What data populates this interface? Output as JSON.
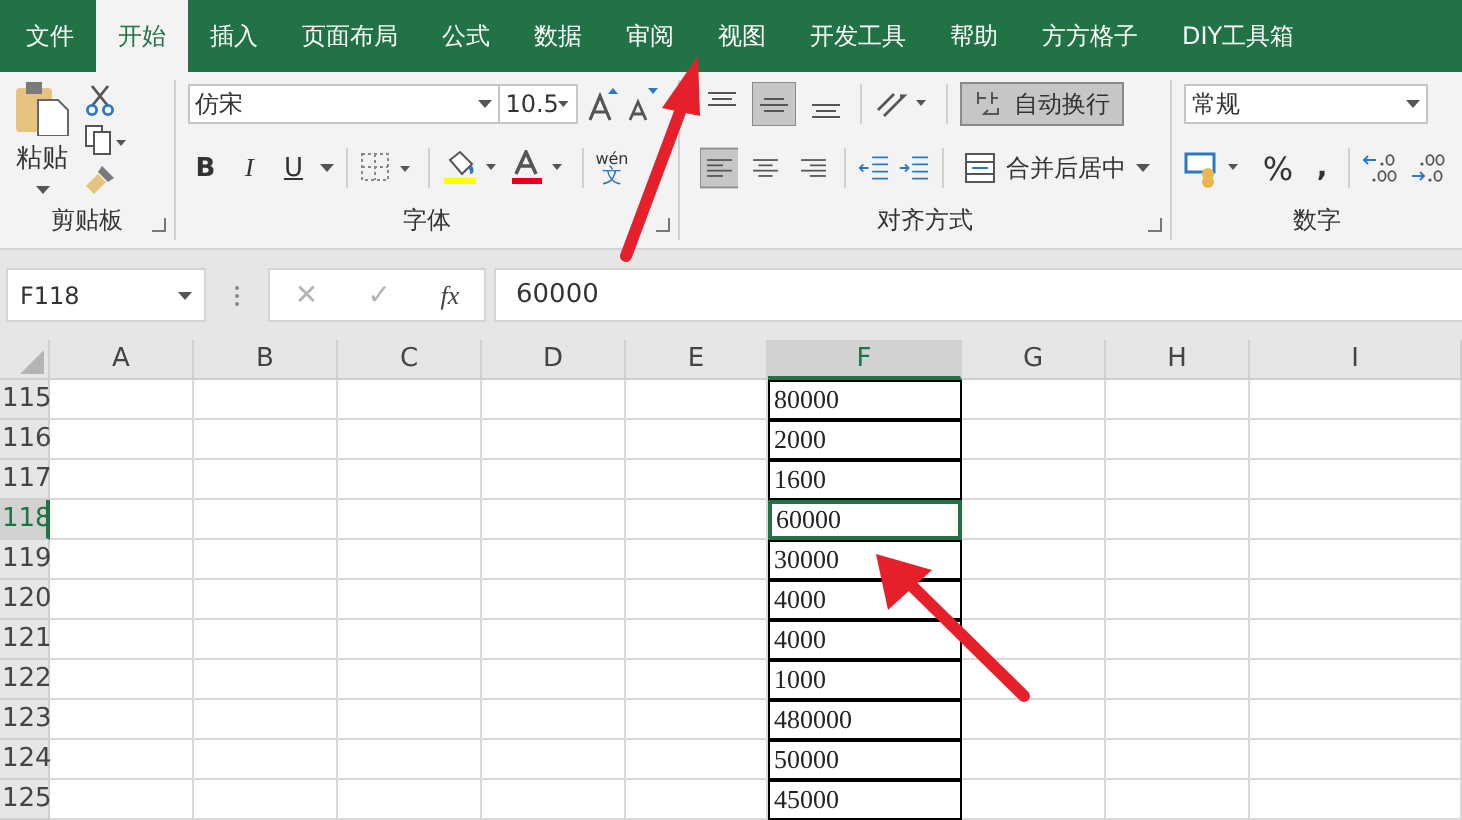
{
  "tabs": [
    {
      "label": "文件",
      "selected": false
    },
    {
      "label": "开始",
      "selected": true
    },
    {
      "label": "插入",
      "selected": false
    },
    {
      "label": "页面布局",
      "selected": false
    },
    {
      "label": "公式",
      "selected": false
    },
    {
      "label": "数据",
      "selected": false
    },
    {
      "label": "审阅",
      "selected": false
    },
    {
      "label": "视图",
      "selected": false
    },
    {
      "label": "开发工具",
      "selected": false
    },
    {
      "label": "帮助",
      "selected": false
    },
    {
      "label": "方方格子",
      "selected": false
    },
    {
      "label": "DIY工具箱",
      "selected": false
    }
  ],
  "clipboard": {
    "paste_label": "粘贴",
    "group_label": "剪贴板"
  },
  "font": {
    "font_name": "仿宋",
    "font_size": "10.5",
    "bold": "B",
    "italic": "I",
    "underline": "U",
    "phonetic_top": "wén",
    "phonetic_bottom": "文",
    "group_label": "字体"
  },
  "alignment": {
    "vertical": [
      {
        "kind": "top",
        "selected": false
      },
      {
        "kind": "middle",
        "selected": true
      },
      {
        "kind": "bottom",
        "selected": false
      }
    ],
    "horizontal": [
      {
        "kind": "left",
        "selected": true
      },
      {
        "kind": "center",
        "selected": false
      },
      {
        "kind": "right",
        "selected": false
      }
    ],
    "wrap_text": {
      "label": "自动换行",
      "selected": true
    },
    "merge_label": "合并后居中",
    "group_label": "对齐方式"
  },
  "number": {
    "format": "常规",
    "percent": "%",
    "comma": ",",
    "group_label": "数字"
  },
  "formula_bar": {
    "name_box": "F118",
    "cancel": "✕",
    "enter": "✓",
    "fx": "fx",
    "value": "60000"
  },
  "columns": [
    {
      "label": "A",
      "selected": false
    },
    {
      "label": "B",
      "selected": false
    },
    {
      "label": "C",
      "selected": false
    },
    {
      "label": "D",
      "selected": false
    },
    {
      "label": "E",
      "selected": false
    },
    {
      "label": "F",
      "selected": true
    },
    {
      "label": "G",
      "selected": false
    },
    {
      "label": "H",
      "selected": false
    },
    {
      "label": "I",
      "selected": false
    }
  ],
  "rows": [
    {
      "number": "115",
      "selected": false,
      "value": "80000"
    },
    {
      "number": "116",
      "selected": false,
      "value": "2000"
    },
    {
      "number": "117",
      "selected": false,
      "value": "1600"
    },
    {
      "number": "118",
      "selected": true,
      "value": "60000"
    },
    {
      "number": "119",
      "selected": false,
      "value": "30000"
    },
    {
      "number": "120",
      "selected": false,
      "value": "4000"
    },
    {
      "number": "121",
      "selected": false,
      "value": "4000"
    },
    {
      "number": "122",
      "selected": false,
      "value": "1000"
    },
    {
      "number": "123",
      "selected": false,
      "value": "480000"
    },
    {
      "number": "124",
      "selected": false,
      "value": "50000"
    },
    {
      "number": "125",
      "selected": false,
      "value": "45000"
    }
  ]
}
